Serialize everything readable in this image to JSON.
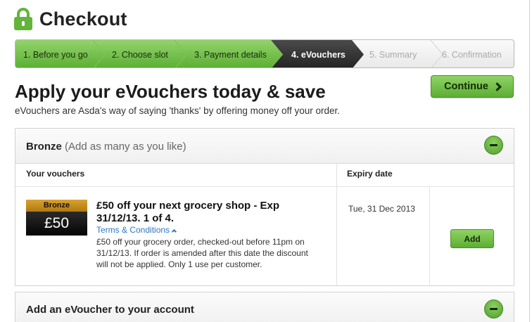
{
  "header": {
    "title": "Checkout",
    "lock_icon": "lock-icon",
    "accent_color": "#62b43a"
  },
  "stepper": {
    "steps": [
      {
        "label": "1. Before you go",
        "state": "done"
      },
      {
        "label": "2. Choose slot",
        "state": "done"
      },
      {
        "label": "3. Payment details",
        "state": "done"
      },
      {
        "label": "4. eVouchers",
        "state": "current"
      },
      {
        "label": "5. Summary",
        "state": "todo"
      },
      {
        "label": "6. Confirmation",
        "state": "todo"
      }
    ]
  },
  "main": {
    "heading": "Apply your eVouchers today & save",
    "subtext": "eVouchers are Asda's way of saying 'thanks' by offering money off your order.",
    "continue_label": "Continue"
  },
  "bronze_panel": {
    "title": "Bronze",
    "title_note": "(Add as many as you like)",
    "col_vouchers": "Your vouchers",
    "col_expiry": "Expiry date",
    "voucher": {
      "badge_tier": "Bronze",
      "badge_value": "£50",
      "title": "£50 off your next grocery shop - Exp 31/12/13. 1 of 4.",
      "terms_label": "Terms & Conditions",
      "description": "£50 off your grocery order, checked-out before 11pm on 31/12/13. If order is amended after this date the discount will not be applied. Only 1 use per customer.",
      "expiry": "Tue, 31 Dec 2013",
      "add_label": "Add"
    }
  },
  "add_panel": {
    "title": "Add an eVoucher to your account"
  }
}
